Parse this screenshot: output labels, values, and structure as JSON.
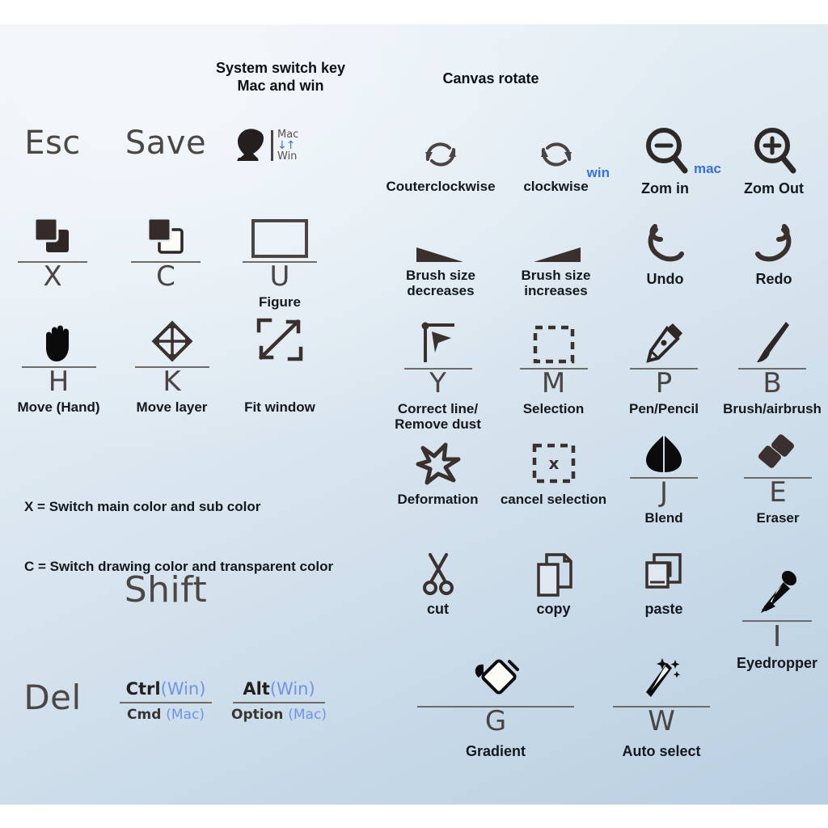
{
  "document": {
    "title": "Drawing app keyboard shortcut cheat sheet",
    "background": {
      "panel_top": "#eef3f8",
      "panel_bottom": "#b9cfe0",
      "page": "#ffffff"
    },
    "accent_color": "#3b6fe0",
    "ink_color": "#3b3230"
  },
  "headings": [
    {
      "id": "system-switch",
      "line1": "System switch key",
      "line2": "Mac and win"
    },
    {
      "id": "canvas-rotate",
      "line1": "Canvas rotate",
      "line2": ""
    }
  ],
  "notes": [
    "X = Switch main color and sub color",
    "C = Switch drawing color and transparent color"
  ],
  "plain_keys": [
    {
      "id": "esc",
      "label": "Esc"
    },
    {
      "id": "save",
      "label": "Save"
    },
    {
      "id": "shift",
      "label": "Shift"
    },
    {
      "id": "del",
      "label": "Del"
    }
  ],
  "system_switch": {
    "icon": "pointing-hand-cursor-icon",
    "mac_label": "Mac",
    "win_label": "Win",
    "arrows": "↓↑"
  },
  "modifier_keys": [
    {
      "id": "ctrl-cmd",
      "win": "Ctrl",
      "win_tag": "(Win)",
      "mac": "Cmd",
      "mac_tag": "(Mac)"
    },
    {
      "id": "alt-option",
      "win": "Alt",
      "win_tag": "(Win)",
      "mac": "Option",
      "mac_tag": "(Mac)"
    }
  ],
  "items": [
    {
      "id": "counterclockwise",
      "icon": "rotate-counterclockwise-icon",
      "key": "",
      "caption": "Couterclockwise",
      "tag": ""
    },
    {
      "id": "clockwise",
      "icon": "rotate-clockwise-icon",
      "key": "",
      "caption": "clockwise",
      "tag": "win"
    },
    {
      "id": "zoom-in",
      "icon": "magnifier-minus-icon",
      "key": "",
      "caption": "Zom in",
      "tag": "mac"
    },
    {
      "id": "zoom-out",
      "icon": "magnifier-plus-icon",
      "key": "",
      "caption": "Zom Out",
      "tag": ""
    },
    {
      "id": "switch-main-sub-color",
      "icon": "two-squares-filled-icon",
      "key": "X",
      "caption": "",
      "tag": ""
    },
    {
      "id": "switch-draw-transparent-color",
      "icon": "two-squares-outline-icon",
      "key": "C",
      "caption": "",
      "tag": ""
    },
    {
      "id": "figure",
      "icon": "rectangle-frame-icon",
      "key": "U",
      "caption": "Figure",
      "tag": ""
    },
    {
      "id": "brush-size-decrease",
      "icon": "wedge-left-icon",
      "key": "",
      "caption": "Brush  size\ndecreases",
      "tag": ""
    },
    {
      "id": "brush-size-increase",
      "icon": "wedge-right-icon",
      "key": "",
      "caption": "Brush  size\nincreases",
      "tag": ""
    },
    {
      "id": "undo",
      "icon": "undo-arrow-icon",
      "key": "",
      "caption": "Undo",
      "tag": ""
    },
    {
      "id": "redo",
      "icon": "redo-arrow-icon",
      "key": "",
      "caption": "Redo",
      "tag": ""
    },
    {
      "id": "move-hand",
      "icon": "hand-icon",
      "key": "H",
      "caption": "Move (Hand)",
      "tag": ""
    },
    {
      "id": "move-layer",
      "icon": "move-layer-icon",
      "key": "K",
      "caption": "Move layer",
      "tag": ""
    },
    {
      "id": "fit-window",
      "icon": "fit-window-icon",
      "key": "",
      "caption": "Fit window",
      "tag": ""
    },
    {
      "id": "correct-line",
      "icon": "correct-line-icon",
      "key": "Y",
      "caption": "Correct line/\nRemove dust",
      "tag": ""
    },
    {
      "id": "selection",
      "icon": "dashed-square-icon",
      "key": "M",
      "caption": "Selection",
      "tag": ""
    },
    {
      "id": "pen-pencil",
      "icon": "pen-nib-icon",
      "key": "P",
      "caption": "Pen/Pencil",
      "tag": ""
    },
    {
      "id": "brush-airbrush",
      "icon": "paintbrush-icon",
      "key": "B",
      "caption": "Brush/airbrush",
      "tag": ""
    },
    {
      "id": "deformation",
      "icon": "deformation-star-icon",
      "key": "",
      "caption": "Deformation",
      "tag": ""
    },
    {
      "id": "cancel-selection",
      "icon": "dashed-square-x-icon",
      "key": "",
      "caption": "cancel selection",
      "tag": ""
    },
    {
      "id": "blend",
      "icon": "blend-drop-icon",
      "key": "J",
      "caption": "Blend",
      "tag": ""
    },
    {
      "id": "eraser",
      "icon": "eraser-icon",
      "key": "E",
      "caption": "Eraser",
      "tag": ""
    },
    {
      "id": "cut",
      "icon": "scissors-icon",
      "key": "",
      "caption": "cut",
      "tag": ""
    },
    {
      "id": "copy",
      "icon": "copy-pages-icon",
      "key": "",
      "caption": "copy",
      "tag": ""
    },
    {
      "id": "paste",
      "icon": "paste-icon",
      "key": "",
      "caption": "paste",
      "tag": ""
    },
    {
      "id": "eyedropper",
      "icon": "eyedropper-icon",
      "key": "I",
      "caption": "Eyedropper",
      "tag": ""
    },
    {
      "id": "gradient",
      "icon": "paint-bucket-icon",
      "key": "G",
      "caption": "Gradient",
      "tag": ""
    },
    {
      "id": "auto-select",
      "icon": "magic-wand-icon",
      "key": "W",
      "caption": "Auto select",
      "tag": ""
    }
  ]
}
